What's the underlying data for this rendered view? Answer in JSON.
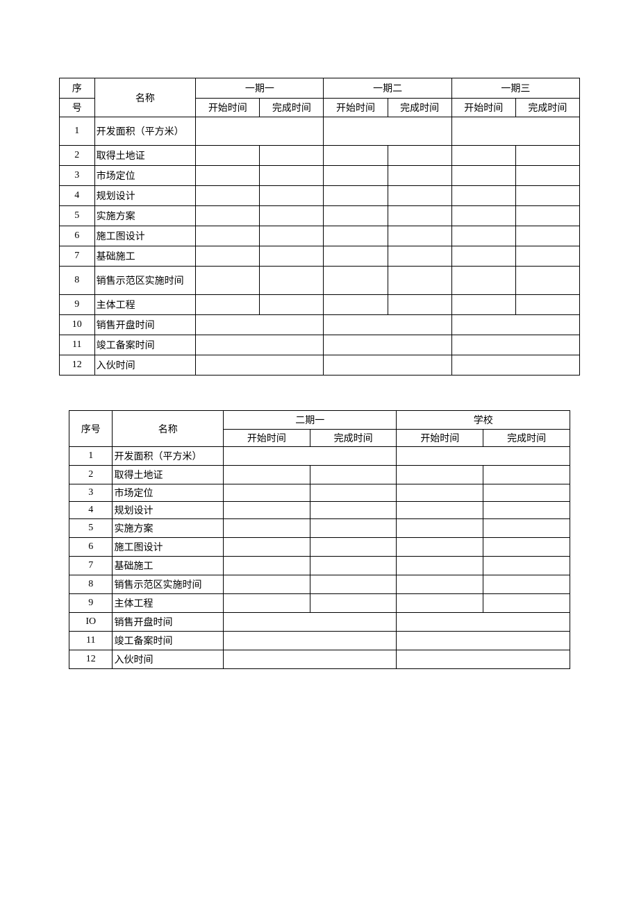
{
  "labels": {
    "seq": "序号",
    "seq_split_top": "序",
    "seq_split_bot": "号",
    "name": "名称",
    "start": "开始时间",
    "end": "完成时间"
  },
  "table1": {
    "phases": [
      "一期一",
      "一期二",
      "一期三"
    ],
    "rows": [
      {
        "n": "1",
        "name": "开发面积（平方米）"
      },
      {
        "n": "2",
        "name": "取得土地证"
      },
      {
        "n": "3",
        "name": "市场定位"
      },
      {
        "n": "4",
        "name": "规划设计"
      },
      {
        "n": "5",
        "name": "实施方案"
      },
      {
        "n": "6",
        "name": "施工图设计"
      },
      {
        "n": "7",
        "name": "基础施工"
      },
      {
        "n": "8",
        "name": "销售示范区实施时间"
      },
      {
        "n": "9",
        "name": "主体工程"
      },
      {
        "n": "10",
        "name": "销售开盘时间"
      },
      {
        "n": "11",
        "name": "竣工备案时间"
      },
      {
        "n": "12",
        "name": "入伙时间"
      }
    ]
  },
  "table2": {
    "phases": [
      "二期一",
      "学校"
    ],
    "rows": [
      {
        "n": "1",
        "name": "开发面积（平方米）"
      },
      {
        "n": "2",
        "name": "取得土地证"
      },
      {
        "n": "3",
        "name": "市场定位"
      },
      {
        "n": "4",
        "name": "规划设计"
      },
      {
        "n": "5",
        "name": "实施方案"
      },
      {
        "n": "6",
        "name": "施工图设计"
      },
      {
        "n": "7",
        "name": "基础施工"
      },
      {
        "n": "8",
        "name": "销售示范区实施时间"
      },
      {
        "n": "9",
        "name": "主体工程"
      },
      {
        "n": "IO",
        "name": "销售开盘时间"
      },
      {
        "n": "11",
        "name": "竣工备案时间"
      },
      {
        "n": "12",
        "name": "入伙时间"
      }
    ]
  }
}
